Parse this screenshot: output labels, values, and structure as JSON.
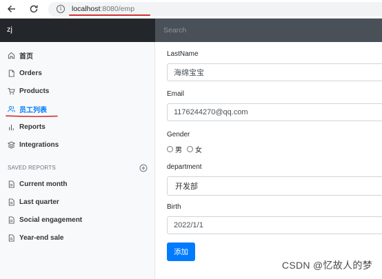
{
  "browser": {
    "url_host": "localhost",
    "url_rest": ":8080/emp"
  },
  "navbar": {
    "brand": "zj",
    "search_placeholder": "Search"
  },
  "sidebar": {
    "items": [
      {
        "label": "首页",
        "icon": "home-icon"
      },
      {
        "label": "Orders",
        "icon": "file-icon"
      },
      {
        "label": "Products",
        "icon": "cart-icon"
      },
      {
        "label": "员工列表",
        "icon": "users-icon",
        "active": true
      },
      {
        "label": "Reports",
        "icon": "bar-chart-icon"
      },
      {
        "label": "Integrations",
        "icon": "layers-icon"
      }
    ],
    "saved_reports_heading": "SAVED REPORTS",
    "saved_reports": [
      {
        "label": "Current month",
        "icon": "file-text-icon"
      },
      {
        "label": "Last quarter",
        "icon": "file-text-icon"
      },
      {
        "label": "Social engagement",
        "icon": "file-text-icon"
      },
      {
        "label": "Year-end sale",
        "icon": "file-text-icon"
      }
    ],
    "accent_color": "#007bff"
  },
  "form": {
    "lastname_label": "LastName",
    "lastname_value": "海绵宝宝",
    "email_label": "Email",
    "email_value": "1176244270@qq.com",
    "gender_label": "Gender",
    "gender_options": [
      "男",
      "女"
    ],
    "department_label": "department",
    "department_value": "开发部",
    "birth_label": "Birth",
    "birth_value": "2022/1/1",
    "submit_label": "添加"
  },
  "watermark": "CSDN @忆故人的梦"
}
